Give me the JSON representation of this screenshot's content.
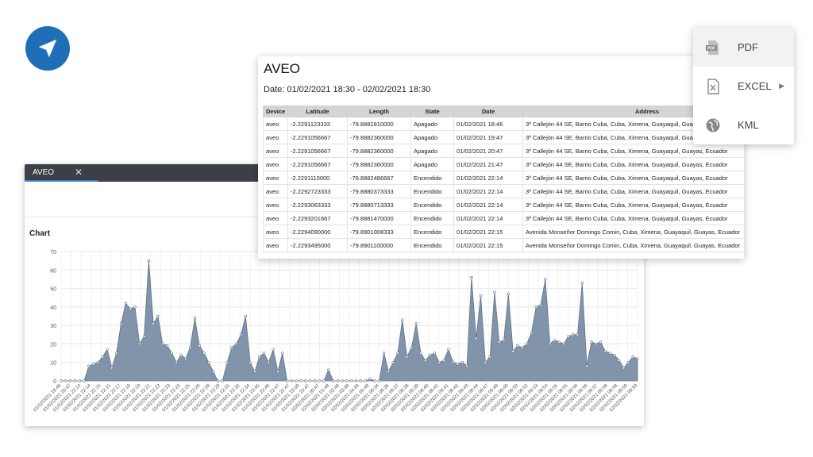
{
  "brand": {
    "icon": "navigation-arrow-icon",
    "color": "#1f6fb8"
  },
  "chart_window": {
    "tab_label": "AVEO",
    "close_label": "✕",
    "section_title": "Chart"
  },
  "report": {
    "title": "AVEO",
    "date_range": "Date: 01/02/2021 18:30 - 02/02/2021 18:30",
    "columns": [
      "Device",
      "Latitude",
      "Length",
      "State",
      "Date",
      "Address"
    ],
    "rows": [
      [
        "aveo",
        "-2.2291123333",
        "-79.8882810000",
        "Apagado",
        "01/02/2021 18:46",
        "3º Callejón 44 SE, Barrio Cuba, Cuba, Ximena, Guayaquil, Guayas, Ecuador"
      ],
      [
        "aveo",
        "-2.2291056667",
        "-79.8882360000",
        "Apagado",
        "01/02/2021 19:47",
        "3º Callejón 44 SE, Barrio Cuba, Cuba, Ximena, Guayaquil, Guayas, Ecuador"
      ],
      [
        "aveo",
        "-2.2291056667",
        "-79.8882360000",
        "Apagado",
        "01/02/2021 20:47",
        "3º Callejón 44 SE, Barrio Cuba, Cuba, Ximena, Guayaquil, Guayas, Ecuador"
      ],
      [
        "aveo",
        "-2.2291056667",
        "-79.8882360000",
        "Apagado",
        "01/02/2021 21:47",
        "3º Callejón 44 SE, Barrio Cuba, Cuba, Ximena, Guayaquil, Guayas, Ecuador"
      ],
      [
        "aveo",
        "-2.2291110000",
        "-79.8882486667",
        "Encendido",
        "01/02/2021 22:14",
        "3º Callejón 44 SE, Barrio Cuba, Cuba, Ximena, Guayaquil, Guayas, Ecuador"
      ],
      [
        "aveo",
        "-2.2292723333",
        "-79.8880373333",
        "Encendido",
        "01/02/2021 22:14",
        "3º Callejón 44 SE, Barrio Cuba, Cuba, Ximena, Guayaquil, Guayas, Ecuador"
      ],
      [
        "aveo",
        "-2.2293063333",
        "-79.8880713333",
        "Encendido",
        "01/02/2021 22:14",
        "3º Callejón 44 SE, Barrio Cuba, Cuba, Ximena, Guayaquil, Guayas, Ecuador"
      ],
      [
        "aveo",
        "-2.2293201667",
        "-79.8881470000",
        "Encendido",
        "01/02/2021 22:14",
        "3º Callejón 44 SE, Barrio Cuba, Cuba, Ximena, Guayaquil, Guayas, Ecuador"
      ],
      [
        "aveo",
        "-2.2294090000",
        "-79.8901008333",
        "Encendido",
        "01/02/2021 22:15",
        "Avenida Monseñor Domingo Comin, Cuba, Ximena, Guayaquil, Guayas, Ecuador"
      ],
      [
        "aveo",
        "-2.2293495000",
        "-79.8901100000",
        "Encendido",
        "01/02/2021 22:15",
        "Avenida Monseñor Domingo Comin, Cuba, Ximena, Guayaquil, Guayas, Ecuador"
      ]
    ]
  },
  "export_menu": {
    "items": [
      {
        "label": "PDF",
        "icon": "pdf-file-icon"
      },
      {
        "label": "EXCEL",
        "icon": "excel-file-icon",
        "submenu_icon": "caret-right-icon"
      },
      {
        "label": "KML",
        "icon": "globe-icon"
      }
    ]
  },
  "chart_data": {
    "type": "area",
    "title": "Chart",
    "xlabel": "",
    "ylabel": "",
    "ylim": [
      0,
      70
    ],
    "yticks": [
      0,
      10,
      20,
      30,
      40,
      50,
      60,
      70
    ],
    "grid": true,
    "fill_color": "#7a8ea4",
    "x_labels": [
      "01/02/2021 18:46",
      "01/02/2021 20:47",
      "01/02/2021 22:14",
      "01/02/2021 22:14",
      "01/02/2021 22:15",
      "01/02/2021 22:15",
      "01/02/2021 22:17",
      "01/02/2021 22:18",
      "01/02/2021 22:19",
      "01/02/2021 22:21",
      "01/02/2021 22:22",
      "01/02/2021 22:23",
      "01/02/2021 22:24",
      "01/02/2021 22:25",
      "01/02/2021 22:26",
      "01/02/2021 22:28",
      "01/02/2021 22:29",
      "01/02/2021 22:31",
      "01/02/2021 22:32",
      "01/02/2021 22:34",
      "01/02/2021 22:45",
      "01/02/2021 22:46",
      "01/02/2021 22:47",
      "01/02/2021 22:47",
      "01/02/2021 23:00",
      "01/02/2021 23:47",
      "02/02/2021 00:47",
      "02/02/2021 01:48",
      "02/02/2021 02:48",
      "02/02/2021 03:48",
      "02/02/2021 04:49",
      "02/02/2021 05:49",
      "02/02/2021 06:34",
      "02/02/2021 06:36",
      "02/02/2021 06:37",
      "02/02/2021 06:38",
      "02/02/2021 06:39",
      "02/02/2021 06:40",
      "02/02/2021 06:41",
      "02/02/2021 06:41",
      "02/02/2021 06:42",
      "02/02/2021 06:43",
      "02/02/2021 06:44",
      "02/02/2021 06:47",
      "02/02/2021 06:48",
      "02/02/2021 06:49",
      "02/02/2021 06:50",
      "02/02/2021 06:52",
      "02/02/2021 06:53",
      "02/02/2021 06:54",
      "02/02/2021 06:55",
      "02/02/2021 06:55",
      "02/02/2021 06:56",
      "02/02/2021 06:56",
      "02/02/2021 06:57",
      "02/02/2021 06:58",
      "02/02/2021 06:58",
      "02/02/2021 06:59",
      "02/02/2021 06:59"
    ],
    "values": [
      0,
      0,
      0,
      0,
      0,
      0,
      8,
      9,
      10,
      13,
      17,
      7,
      15,
      31,
      42,
      39,
      40,
      20,
      24,
      65,
      31,
      35,
      20,
      19,
      15,
      10,
      14,
      12,
      18,
      34,
      19,
      15,
      10,
      5,
      0,
      0,
      10,
      18,
      20,
      25,
      35,
      10,
      5,
      13,
      15,
      10,
      17,
      5,
      15,
      0,
      0,
      0,
      0,
      0,
      0,
      0,
      0,
      0,
      6,
      0,
      0,
      0,
      0,
      0,
      0,
      0,
      0,
      1,
      0,
      0,
      15,
      5,
      10,
      15,
      33,
      13,
      18,
      31,
      15,
      11,
      14,
      15,
      10,
      11,
      17,
      10,
      9,
      10,
      8,
      56,
      23,
      46,
      10,
      13,
      48,
      21,
      22,
      47,
      16,
      19,
      18,
      20,
      26,
      40,
      41,
      55,
      20,
      22,
      21,
      20,
      24,
      25,
      25,
      53,
      8,
      21,
      20,
      21,
      16,
      15,
      14,
      11,
      7,
      10,
      13,
      12
    ]
  }
}
